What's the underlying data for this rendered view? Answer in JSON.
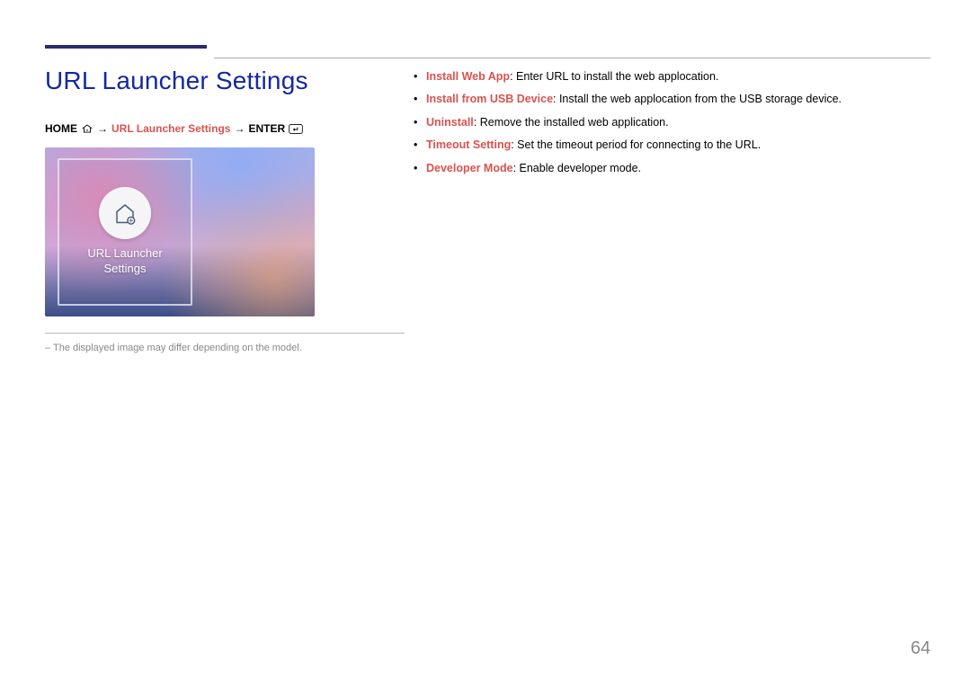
{
  "title": "URL Launcher Settings",
  "breadcrumb": {
    "home": "HOME",
    "path": "URL Launcher Settings",
    "enter": "ENTER"
  },
  "thumbnail": {
    "label_line1": "URL Launcher",
    "label_line2": "Settings"
  },
  "note": "The displayed image may differ depending on the model.",
  "bullets": [
    {
      "term": "Install Web App",
      "desc": ": Enter URL to install the web applocation."
    },
    {
      "term": "Install from USB Device",
      "desc": ": Install the web applocation from the USB storage device."
    },
    {
      "term": "Uninstall",
      "desc": ": Remove the installed web application."
    },
    {
      "term": "Timeout Setting",
      "desc": ": Set the timeout period for connecting to the URL."
    },
    {
      "term": "Developer Mode",
      "desc": ": Enable developer mode."
    }
  ],
  "page_number": "64"
}
